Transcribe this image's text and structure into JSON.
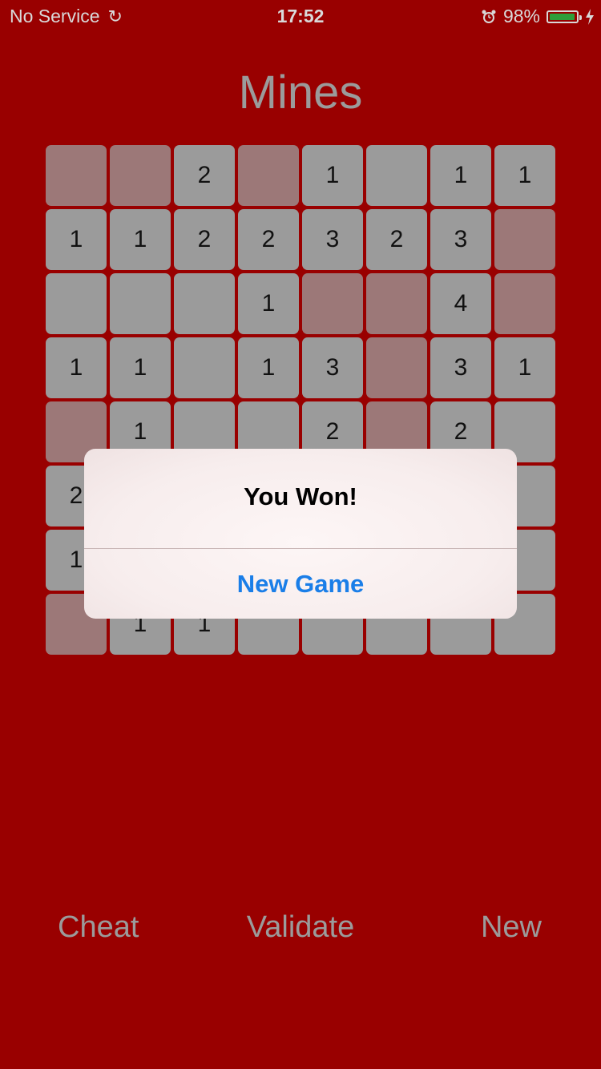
{
  "status_bar": {
    "carrier": "No Service",
    "time": "17:52",
    "battery_percent": "98%",
    "battery_level": 0.98,
    "battery_color": "#2f9e3a"
  },
  "title": "Mines",
  "board": {
    "rows": [
      [
        {
          "state": "flag",
          "value": ""
        },
        {
          "state": "flag",
          "value": ""
        },
        {
          "state": "open",
          "value": "2"
        },
        {
          "state": "flag",
          "value": ""
        },
        {
          "state": "open",
          "value": "1"
        },
        {
          "state": "open",
          "value": ""
        },
        {
          "state": "open",
          "value": "1"
        },
        {
          "state": "open",
          "value": "1"
        }
      ],
      [
        {
          "state": "open",
          "value": "1"
        },
        {
          "state": "open",
          "value": "1"
        },
        {
          "state": "open",
          "value": "2"
        },
        {
          "state": "open",
          "value": "2"
        },
        {
          "state": "open",
          "value": "3"
        },
        {
          "state": "open",
          "value": "2"
        },
        {
          "state": "open",
          "value": "3"
        },
        {
          "state": "flag",
          "value": ""
        }
      ],
      [
        {
          "state": "open",
          "value": ""
        },
        {
          "state": "open",
          "value": ""
        },
        {
          "state": "open",
          "value": ""
        },
        {
          "state": "open",
          "value": "1"
        },
        {
          "state": "flag",
          "value": ""
        },
        {
          "state": "flag",
          "value": ""
        },
        {
          "state": "open",
          "value": "4"
        },
        {
          "state": "flag",
          "value": ""
        }
      ],
      [
        {
          "state": "open",
          "value": "1"
        },
        {
          "state": "open",
          "value": "1"
        },
        {
          "state": "open",
          "value": ""
        },
        {
          "state": "open",
          "value": "1"
        },
        {
          "state": "open",
          "value": "3"
        },
        {
          "state": "flag",
          "value": ""
        },
        {
          "state": "open",
          "value": "3"
        },
        {
          "state": "open",
          "value": "1"
        }
      ],
      [
        {
          "state": "flag",
          "value": ""
        },
        {
          "state": "open",
          "value": "1"
        },
        {
          "state": "open",
          "value": ""
        },
        {
          "state": "open",
          "value": ""
        },
        {
          "state": "open",
          "value": "2"
        },
        {
          "state": "flag",
          "value": ""
        },
        {
          "state": "open",
          "value": "2"
        },
        {
          "state": "open",
          "value": ""
        }
      ],
      [
        {
          "state": "open",
          "value": "2"
        },
        {
          "state": "open",
          "value": ""
        },
        {
          "state": "open",
          "value": ""
        },
        {
          "state": "open",
          "value": ""
        },
        {
          "state": "open",
          "value": ""
        },
        {
          "state": "open",
          "value": ""
        },
        {
          "state": "open",
          "value": ""
        },
        {
          "state": "open",
          "value": ""
        }
      ],
      [
        {
          "state": "open",
          "value": "1"
        },
        {
          "state": "open",
          "value": ""
        },
        {
          "state": "open",
          "value": ""
        },
        {
          "state": "open",
          "value": ""
        },
        {
          "state": "open",
          "value": ""
        },
        {
          "state": "open",
          "value": ""
        },
        {
          "state": "open",
          "value": ""
        },
        {
          "state": "open",
          "value": ""
        }
      ],
      [
        {
          "state": "flag",
          "value": ""
        },
        {
          "state": "open",
          "value": "1"
        },
        {
          "state": "open",
          "value": "1"
        },
        {
          "state": "open",
          "value": ""
        },
        {
          "state": "open",
          "value": ""
        },
        {
          "state": "open",
          "value": ""
        },
        {
          "state": "open",
          "value": ""
        },
        {
          "state": "open",
          "value": ""
        }
      ]
    ]
  },
  "alert": {
    "title": "You Won!",
    "button_label": "New Game"
  },
  "toolbar": {
    "cheat_label": "Cheat",
    "validate_label": "Validate",
    "new_label": "New"
  },
  "colors": {
    "background": "#990000",
    "cell_open": "#9b9b9b",
    "cell_flag": "#9c7878",
    "accent": "#1a7ee8"
  }
}
